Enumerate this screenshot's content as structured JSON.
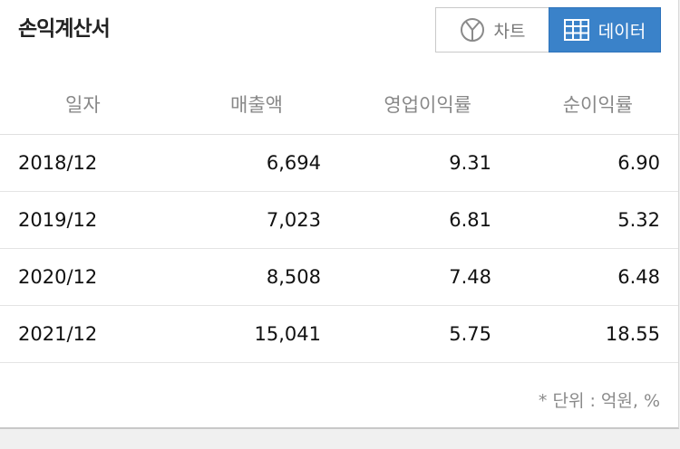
{
  "header": {
    "title": "손익계산서",
    "chart_button_label": "차트",
    "data_button_label": "데이터",
    "active_tab": "데이터"
  },
  "table": {
    "columns": [
      "일자",
      "매출액",
      "영업이익률",
      "순이익률"
    ],
    "rows": [
      {
        "date": "2018/12",
        "sales": "6,694",
        "op_margin": "9.31",
        "net_margin": "6.90"
      },
      {
        "date": "2019/12",
        "sales": "7,023",
        "op_margin": "6.81",
        "net_margin": "5.32"
      },
      {
        "date": "2020/12",
        "sales": "8,508",
        "op_margin": "7.48",
        "net_margin": "6.48"
      },
      {
        "date": "2021/12",
        "sales": "15,041",
        "op_margin": "5.75",
        "net_margin": "18.55"
      }
    ]
  },
  "footer": {
    "unit_note": "* 단위 : 억원, %"
  },
  "colors": {
    "accent": "#3a82c9",
    "accent_border": "#2e73bc",
    "muted_text": "#888888"
  },
  "icons": {
    "chart": "pie-chart-icon",
    "data": "table-grid-icon"
  }
}
